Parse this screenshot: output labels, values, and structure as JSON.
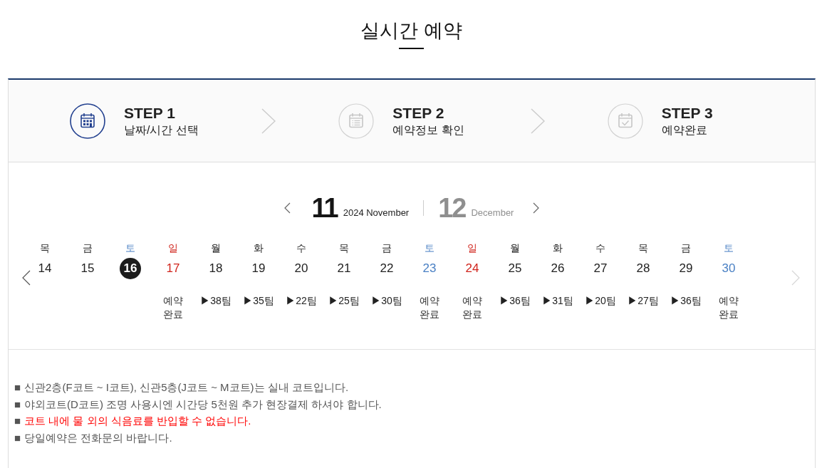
{
  "title": "실시간 예약",
  "steps": [
    {
      "label": "STEP 1",
      "caption": "날짜/시간 선택",
      "active": true
    },
    {
      "label": "STEP 2",
      "caption": "예약정보 확인",
      "active": false
    },
    {
      "label": "STEP 3",
      "caption": "예약완료",
      "active": false
    }
  ],
  "calendar": {
    "months": [
      {
        "number": "11",
        "label": "2024 November",
        "selected": true
      },
      {
        "number": "12",
        "label": "December",
        "selected": false
      }
    ],
    "prev_week": {
      "disabled": false
    },
    "next_week": {
      "disabled": true
    },
    "days": [
      {
        "weekday": "목",
        "date": "14",
        "kind": "weekday",
        "selected": false
      },
      {
        "weekday": "금",
        "date": "15",
        "kind": "weekday",
        "selected": false
      },
      {
        "weekday": "토",
        "date": "16",
        "kind": "saturday",
        "selected": true
      },
      {
        "weekday": "일",
        "date": "17",
        "kind": "sunday",
        "selected": false,
        "status": {
          "kind": "full",
          "text": "예약완료"
        }
      },
      {
        "weekday": "월",
        "date": "18",
        "kind": "weekday",
        "selected": false,
        "status": {
          "kind": "teams",
          "text": "▶38팀"
        }
      },
      {
        "weekday": "화",
        "date": "19",
        "kind": "weekday",
        "selected": false,
        "status": {
          "kind": "teams",
          "text": "▶35팀"
        }
      },
      {
        "weekday": "수",
        "date": "20",
        "kind": "weekday",
        "selected": false,
        "status": {
          "kind": "teams",
          "text": "▶22팀"
        }
      },
      {
        "weekday": "목",
        "date": "21",
        "kind": "weekday",
        "selected": false,
        "status": {
          "kind": "teams",
          "text": "▶25팀"
        }
      },
      {
        "weekday": "금",
        "date": "22",
        "kind": "weekday",
        "selected": false,
        "status": {
          "kind": "teams",
          "text": "▶30팀"
        }
      },
      {
        "weekday": "토",
        "date": "23",
        "kind": "saturday",
        "selected": false,
        "status": {
          "kind": "full",
          "text": "예약완료"
        }
      },
      {
        "weekday": "일",
        "date": "24",
        "kind": "sunday",
        "selected": false,
        "status": {
          "kind": "full",
          "text": "예약완료"
        }
      },
      {
        "weekday": "월",
        "date": "25",
        "kind": "weekday",
        "selected": false,
        "status": {
          "kind": "teams",
          "text": "▶36팀"
        }
      },
      {
        "weekday": "화",
        "date": "26",
        "kind": "weekday",
        "selected": false,
        "status": {
          "kind": "teams",
          "text": "▶31팀"
        }
      },
      {
        "weekday": "수",
        "date": "27",
        "kind": "weekday",
        "selected": false,
        "status": {
          "kind": "teams",
          "text": "▶20팀"
        }
      },
      {
        "weekday": "목",
        "date": "28",
        "kind": "weekday",
        "selected": false,
        "status": {
          "kind": "teams",
          "text": "▶27팀"
        }
      },
      {
        "weekday": "금",
        "date": "29",
        "kind": "weekday",
        "selected": false,
        "status": {
          "kind": "teams",
          "text": "▶36팀"
        }
      },
      {
        "weekday": "토",
        "date": "30",
        "kind": "saturday",
        "selected": false,
        "status": {
          "kind": "full",
          "text": "예약완료"
        }
      }
    ]
  },
  "notices": [
    {
      "bullet": "■",
      "text": "신관2층(F코트 ~ I코트), 신관5층(J코트 ~ M코트)는 실내 코트입니다.",
      "highlight": false
    },
    {
      "bullet": "■",
      "text": "야외코트(D코트) 조명 사용시엔 시간당 5천원 추가 현장결제 하셔야 합니다.",
      "highlight": false
    },
    {
      "bullet": "■",
      "text": "코트 내에 물 외의 식음료를 반입할 수 없습니다.",
      "highlight": true
    },
    {
      "bullet": "■",
      "text": "당일예약은 전화문의 바랍니다.",
      "highlight": false
    }
  ]
}
